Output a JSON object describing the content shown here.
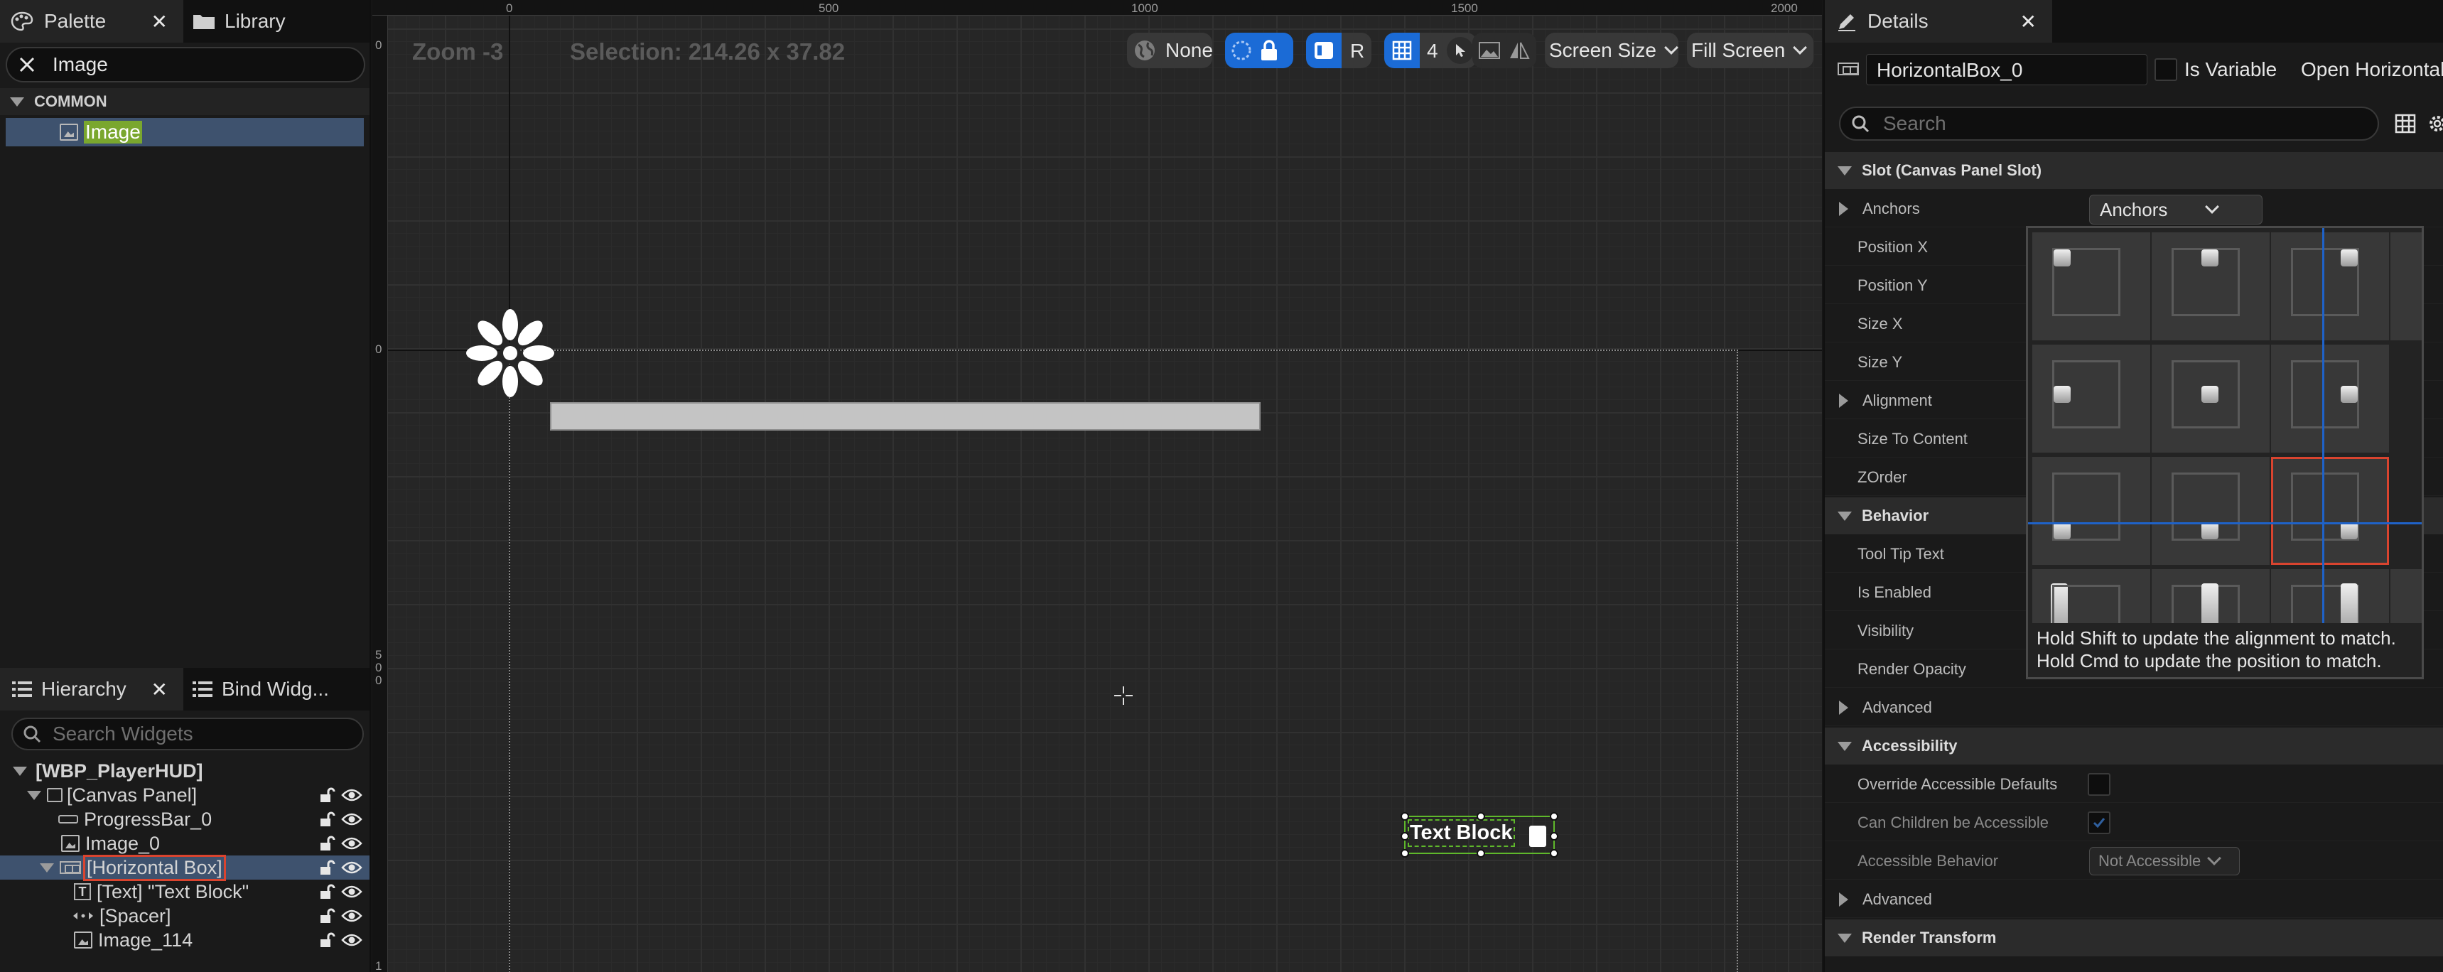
{
  "palette": {
    "tab_palette": "Palette",
    "tab_library": "Library",
    "search_value": "Image",
    "category": "COMMON",
    "item_label": "Image"
  },
  "hierarchy": {
    "tab_hierarchy": "Hierarchy",
    "tab_bind": "Bind Widg...",
    "search_placeholder": "Search Widgets",
    "items": [
      {
        "label": "[WBP_PlayerHUD]"
      },
      {
        "label": "[Canvas Panel]"
      },
      {
        "label": "ProgressBar_0"
      },
      {
        "label": "Image_0"
      },
      {
        "label": "[Horizontal Box]"
      },
      {
        "label": "[Text] \"Text Block\""
      },
      {
        "label": "[Spacer]"
      },
      {
        "label": "Image_114"
      }
    ]
  },
  "viewport": {
    "zoom": "Zoom -3",
    "selection": "Selection: 214.26 x 37.82",
    "ruler_top": [
      "0",
      "500",
      "1000",
      "1500",
      "2000"
    ],
    "ruler_left": [
      "0",
      "0",
      "5",
      "0",
      "0",
      "1"
    ],
    "toolbar": {
      "none_label": "None",
      "r_label": "R",
      "grid_value": "4",
      "screen_size": "Screen Size",
      "fill_screen": "Fill Screen"
    },
    "text_block": "Text Block"
  },
  "details": {
    "tab": "Details",
    "name_value": "HorizontalBox_0",
    "is_variable": "Is Variable",
    "open_label": "Open Horizontal",
    "search_placeholder": "Search",
    "sections": {
      "slot": "Slot (Canvas Panel Slot)",
      "behavior": "Behavior",
      "accessibility": "Accessibility",
      "render_transform": "Render Transform"
    },
    "props": {
      "anchors": "Anchors",
      "position_x": "Position X",
      "position_y": "Position Y",
      "size_x": "Size X",
      "size_y": "Size Y",
      "alignment": "Alignment",
      "size_to_content": "Size To Content",
      "zorder": "ZOrder",
      "tool_tip": "Tool Tip Text",
      "is_enabled": "Is Enabled",
      "visibility": "Visibility",
      "render_opacity": "Render Opacity",
      "advanced": "Advanced",
      "override_accessible": "Override Accessible Defaults",
      "can_children": "Can Children be Accessible",
      "accessible_behavior": "Accessible Behavior",
      "advanced2": "Advanced"
    },
    "anchors_dropdown": "Anchors",
    "accessible_dropdown": "Not Accessible",
    "anchor_hint_1": "Hold Shift to update the alignment to match.",
    "anchor_hint_2": "Hold Cmd to update the position to match."
  },
  "colors": {
    "accent_blue": "#1b6bd6",
    "selection_row": "#3e526e",
    "highlight_green": "#7aa72e",
    "selection_red": "#d9442f"
  }
}
